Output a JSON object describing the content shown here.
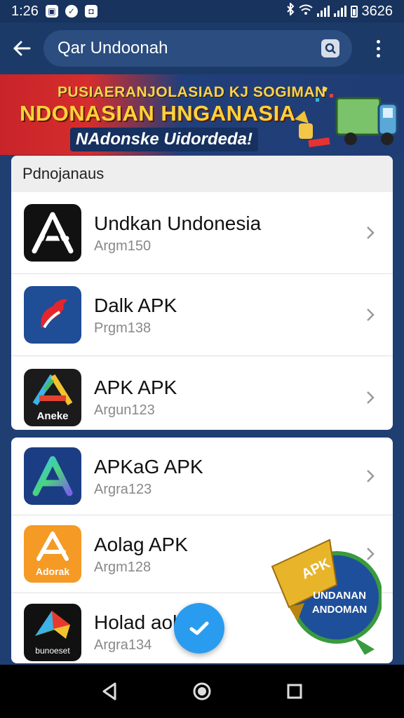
{
  "status_bar": {
    "time": "1:26",
    "battery_text": "3626",
    "icons": [
      "gallery-icon",
      "messenger-icon",
      "notification-icon",
      "bluetooth-icon",
      "wifi-icon",
      "signal-icon",
      "signal-icon",
      "battery-icon"
    ]
  },
  "app_bar": {
    "back_icon": "arrow-left-icon",
    "search_value": "Qar Undoonah",
    "search_icon": "search-icon",
    "more_icon": "more-vertical-icon"
  },
  "banner": {
    "line1": "PUSIAERANJOLASIAD KJ SOGIMAN",
    "line2": "NDONASIAN HNGANASIA",
    "line3": "NAdonske Uidordeda!"
  },
  "section1": {
    "header": "Pdnojanaus",
    "items": [
      {
        "title": "Undkan Undonesia",
        "subtitle": "Argm150",
        "icon": "a-logo-icon",
        "icon_bg": "#111111"
      },
      {
        "title": "Dalk APK",
        "subtitle": "Prgm138",
        "icon": "red-bird-icon",
        "icon_bg": "#1f4d96"
      },
      {
        "title": "APK APK",
        "subtitle": "Argun123",
        "icon": "rainbow-triangle-icon",
        "icon_bg": "#1b1b1b",
        "icon_text": "Aneke"
      }
    ]
  },
  "section2": {
    "items": [
      {
        "title": "APKaG APK",
        "subtitle": "Argra123",
        "icon": "gradient-a-icon",
        "icon_bg": "#1b3d84"
      },
      {
        "title": "Aolag APK",
        "subtitle": "Argm128",
        "icon": "orange-a-icon",
        "icon_bg": "#f59a24",
        "icon_text": "Adorak"
      },
      {
        "title": "Holad aoh",
        "subtitle": "Argra134",
        "icon": "kite-icon",
        "icon_bg": "#111111",
        "icon_text": "bunoeset"
      }
    ]
  },
  "fab": {
    "icon": "check-icon"
  },
  "badge": {
    "ribbon": "APK",
    "line1": "UNDANAN",
    "line2": "ANDOMAN"
  },
  "nav": {
    "back_icon": "triangle-back-icon",
    "home_icon": "circle-home-icon",
    "recents_icon": "square-recents-icon"
  },
  "colors": {
    "accent": "#2a9cf0",
    "app_bar": "#1b3a68",
    "banner_red": "#d62d2d",
    "banner_gold": "#ffd23a"
  }
}
